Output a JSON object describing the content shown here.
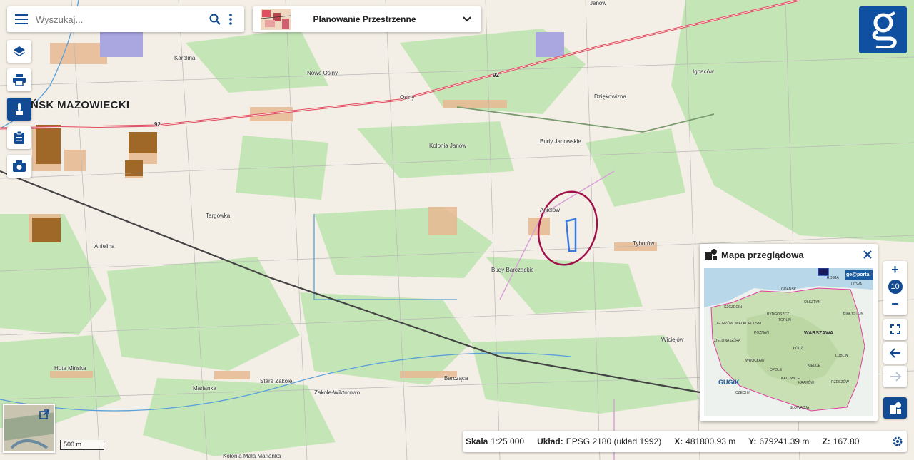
{
  "search": {
    "placeholder": "Wyszukaj..."
  },
  "theme": {
    "title": "Planowanie Przestrzenne"
  },
  "map": {
    "labels": {
      "minsk": "ŃSK MAZOWIECKI",
      "karolina": "Karolina",
      "nowe_osiny": "Nowe Osiny",
      "osiny": "Osiny",
      "janow": "Janów",
      "ignacow": "Ignaców",
      "dziekowizna": "Dziękowizna",
      "kolonia_janow": "Kolonia Janów",
      "budy_janowskie": "Budy Janowskie",
      "targowka": "Targówka",
      "anielina": "Anielina",
      "aniolow": "Anielów",
      "tyborow": "Tyborów",
      "budy_barczackie": "Budy Barcząckie",
      "wiciejow": "Wiciejów",
      "huta_minska": "Huta Mińska",
      "marianka": "Marianka",
      "stare_zakole": "Stare Zakole",
      "zakole_wiktorowo": "Zakole-Wiktorowo",
      "barczaca": "Barcząca",
      "kolonia_mala_marianka": "Kolonia Mała Marianka",
      "road_92_a": "92",
      "road_92_b": "92"
    }
  },
  "overview": {
    "title": "Mapa przeglądowa",
    "labels": {
      "geoportal": "ge@portal",
      "rosja": "ROSJA",
      "litwa": "LITWA",
      "gdansk": "GDAŃSK",
      "olsztyn": "OLSZTYN",
      "szczecin": "SZCZECIN",
      "bydgoszcz": "BYDGOSZCZ",
      "torun": "TORUŃ",
      "bialystok": "BIAŁYSTOK",
      "gorzow": "GORZÓW WIELKOPOLSKI",
      "poznan": "POZNAŃ",
      "warszawa": "WARSZAWA",
      "zielona_gora": "ZIELONA GÓRA",
      "lodz": "ŁÓDŹ",
      "wroclaw": "WROCŁAW",
      "kielce": "KIELCE",
      "lublin": "LUBLIN",
      "opole": "OPOLE",
      "katowice": "KATOWICE",
      "krakow": "KRAKÓW",
      "rzeszow": "RZESZÓW",
      "czechy": "CZECHY",
      "slowacja": "SŁOWACJA",
      "gugik": "GUGiK"
    }
  },
  "zoom": {
    "level": "10",
    "in": "+",
    "out": "−"
  },
  "scale_bar": "500 m",
  "status": {
    "scale_label": "Skala",
    "scale_value": "1:25 000",
    "crs_label": "Układ:",
    "crs_value": "EPSG 2180 (układ 1992)",
    "x_label": "X:",
    "x_value": "481800.93 m",
    "y_label": "Y:",
    "y_value": "679241.39 m",
    "z_label": "Z:",
    "z_value": "167.80"
  },
  "colors": {
    "accent": "#124a94",
    "forest": "#bfe2b0",
    "open": "#f4efe6",
    "built": "#e8b890",
    "road": "#e05060",
    "marker": "#a0104a",
    "parcel": "#3a7ae0"
  },
  "icons": [
    "menu-icon",
    "search-icon",
    "more-vert-icon",
    "chevron-down-icon",
    "layers-icon",
    "print-icon",
    "measure-icon",
    "clipboard-icon",
    "camera-icon",
    "close-icon",
    "fullscreen-icon",
    "back-arrow-icon",
    "forward-arrow-icon",
    "overview-map-icon",
    "settings-icon",
    "external-link-icon"
  ]
}
